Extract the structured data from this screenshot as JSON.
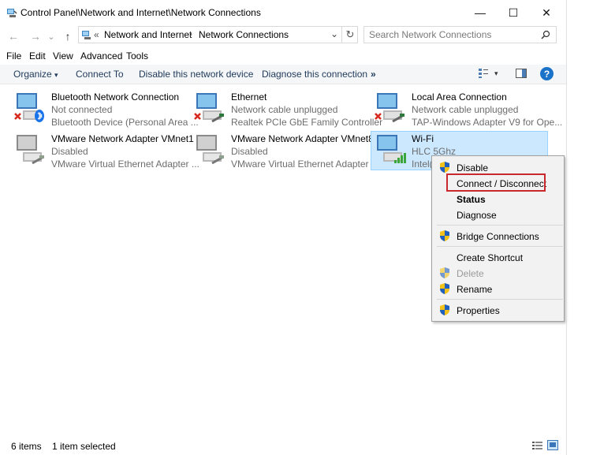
{
  "window": {
    "title": "Control Panel\\Network and Internet\\Network Connections",
    "minimize_glyph": "—",
    "maximize_glyph": "☐",
    "close_glyph": "✕"
  },
  "address": {
    "back_glyph": "←",
    "forward_glyph": "→",
    "recent_glyph": "⌄",
    "up_glyph": "↑",
    "overflow_glyph": "«",
    "crumb1": "Network and Internet",
    "sep_glyph": "›",
    "crumb2": "Network Connections",
    "dropdown_glyph": "⌄",
    "refresh_glyph": "↻",
    "search_placeholder": "Search Network Connections"
  },
  "menu": {
    "items": [
      "File",
      "Edit",
      "View",
      "Advanced",
      "Tools"
    ]
  },
  "commands": {
    "organize": "Organize",
    "organize_caret": "▾",
    "connect_to": "Connect To",
    "disable": "Disable this network device",
    "diagnose": "Diagnose this connection",
    "more": "»",
    "help": "?"
  },
  "connections": [
    {
      "name": "Bluetooth Network Connection",
      "status": "Not connected",
      "device": "Bluetooth Device (Personal Area ..."
    },
    {
      "name": "Ethernet",
      "status": "Network cable unplugged",
      "device": "Realtek PCIe GbE Family Controller"
    },
    {
      "name": "Local Area Connection",
      "status": "Network cable unplugged",
      "device": "TAP-Windows Adapter V9 for Ope..."
    },
    {
      "name": "VMware Network Adapter VMnet1",
      "status": "Disabled",
      "device": "VMware Virtual Ethernet Adapter ..."
    },
    {
      "name": "VMware Network Adapter VMnet8",
      "status": "Disabled",
      "device": "VMware Virtual Ethernet Adapter ..."
    },
    {
      "name": "Wi-Fi",
      "status": "HLC 5Ghz",
      "device": "Intel("
    }
  ],
  "context_menu": {
    "disable": "Disable",
    "connect_disconnect": "Connect / Disconnect",
    "status": "Status",
    "diagnose": "Diagnose",
    "bridge": "Bridge Connections",
    "create_shortcut": "Create Shortcut",
    "delete": "Delete",
    "rename": "Rename",
    "properties": "Properties"
  },
  "status_bar": {
    "count": "6 items",
    "selected": "1 item selected"
  },
  "colors": {
    "accent": "#0078d7",
    "selection": "#cce8ff",
    "highlight_box": "#c8282e",
    "error_red": "#d7281e",
    "bluetooth_blue": "#1a73e8",
    "signal_green": "#3aa63a"
  }
}
